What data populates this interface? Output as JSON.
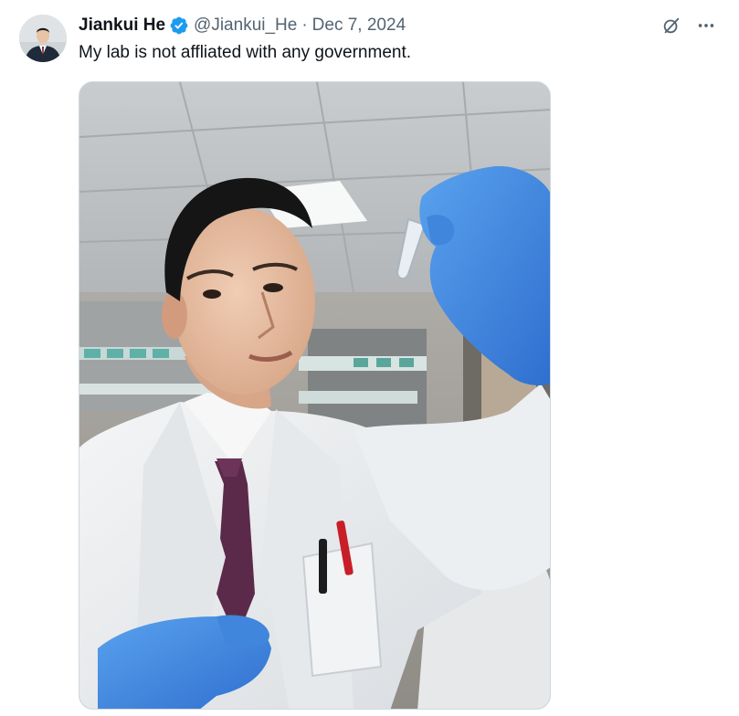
{
  "tweet": {
    "author_name": "Jiankui He",
    "verified": true,
    "handle": "@Jiankui_He",
    "separator": "·",
    "date": "Dec 7, 2024",
    "text": "My lab is not affliated with any government."
  },
  "actions": {
    "grok_icon": "grok-icon",
    "more_icon": "more-icon"
  },
  "colors": {
    "verified_badge": "#1d9bf0",
    "secondary_text": "#536471",
    "primary_text": "#0f1419"
  }
}
